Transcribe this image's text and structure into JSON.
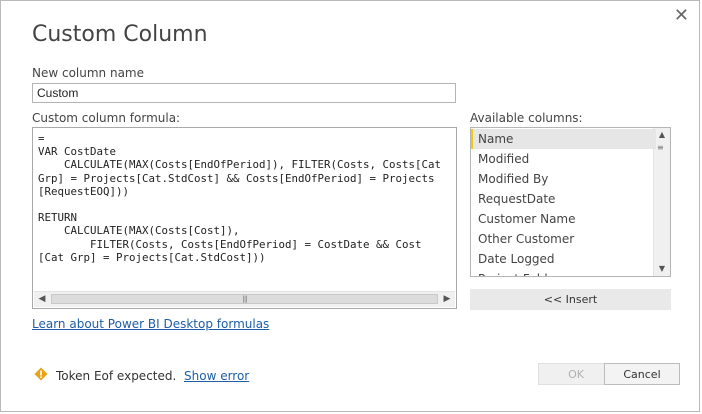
{
  "dialog": {
    "title": "Custom Column",
    "close_glyph": "✕"
  },
  "new_column": {
    "label": "New column name",
    "value": "Custom"
  },
  "formula": {
    "label": "Custom column formula:",
    "lines": [
      "=",
      "VAR CostDate",
      "    CALCULATE(MAX(Costs[EndOfPeriod]), FILTER(Costs, Costs[Cat",
      "Grp] = Projects[Cat.StdCost] && Costs[EndOfPeriod] = Projects",
      "[RequestEOQ]))",
      "",
      "RETURN",
      "    CALCULATE(MAX(Costs[Cost]),",
      "        FILTER(Costs, Costs[EndOfPeriod] = CostDate && Cost",
      "[Cat Grp] = Projects[Cat.StdCost]))"
    ]
  },
  "available": {
    "label": "Available columns:",
    "items": [
      "Name",
      "Modified",
      "Modified By",
      "RequestDate",
      "Customer Name",
      "Other Customer",
      "Date Logged",
      "Project Folder"
    ],
    "selected_index": 0
  },
  "insert_label": "<< Insert",
  "learn_link": "Learn about Power BI Desktop formulas",
  "error": {
    "message": "Token Eof expected.",
    "show_error_label": "Show error"
  },
  "buttons": {
    "ok": "OK",
    "cancel": "Cancel"
  },
  "colors": {
    "selection_accent": "#f2c811",
    "link": "#1d5ea7",
    "warning": "#e8a317"
  }
}
